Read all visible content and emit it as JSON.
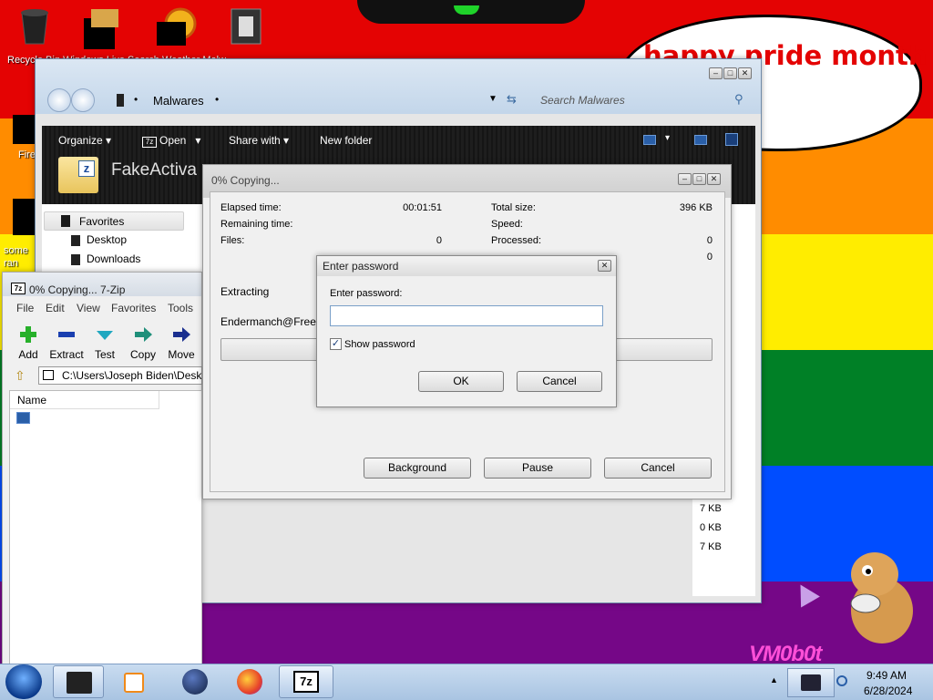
{
  "desktop": {
    "icons": [
      {
        "label": "Recycle Bin Windows Live Search Weather Malw",
        "icon": "recycle-bin-icon"
      },
      {
        "label": "Fire",
        "icon": "firefox-shortcut-icon"
      },
      {
        "label": "some ran",
        "icon": "file-icon"
      }
    ],
    "speech_bubble": "happy pride month",
    "watermark": "VM0b0t",
    "colors": {
      "red": "#e40303",
      "orange": "#ff8c00",
      "yellow": "#ffed00",
      "green": "#008026",
      "blue": "#004dff",
      "purple": "#750787"
    }
  },
  "explorer": {
    "address_folder": "Malwares",
    "search_placeholder": "Search Malwares",
    "toolbar": {
      "organize": "Organize",
      "open": "Open",
      "share_with": "Share with",
      "new_folder": "New folder"
    },
    "folder_title": "FakeActiva",
    "nav": {
      "favorites": "Favorites",
      "desktop": "Desktop",
      "downloads": "Downloads"
    },
    "sizes": [
      "7 KB",
      "0 KB",
      "7 KB"
    ]
  },
  "sevenzip": {
    "title": "0% Copying... 7-Zip",
    "menu": [
      "File",
      "Edit",
      "View",
      "Favorites",
      "Tools"
    ],
    "tools": [
      {
        "label": "Add",
        "icon": "add-plus-icon"
      },
      {
        "label": "Extract",
        "icon": "extract-minus-icon"
      },
      {
        "label": "Test",
        "icon": "test-check-icon"
      },
      {
        "label": "Copy",
        "icon": "copy-arrow-icon"
      },
      {
        "label": "Move",
        "icon": "move-arrow-icon"
      }
    ],
    "path": "C:\\Users\\Joseph Biden\\Deskt",
    "column_name": "Name"
  },
  "copying": {
    "title": "0% Copying...",
    "elapsed_label": "Elapsed time:",
    "elapsed_value": "00:01:51",
    "remaining_label": "Remaining time:",
    "files_label": "Files:",
    "files_value": "0",
    "total_label": "Total size:",
    "total_value": "396 KB",
    "speed_label": "Speed:",
    "processed_label": "Processed:",
    "processed_value": "0",
    "compressed_value": "0",
    "extracting_label": "Extracting",
    "file_label": "Endermanch@FreeYo",
    "progress": 0,
    "background_button": "Background",
    "pause_button": "Pause",
    "cancel_button": "Cancel"
  },
  "password": {
    "title": "Enter password",
    "prompt": "Enter password:",
    "value": "",
    "show_password": "Show password",
    "show_checked": true,
    "ok_button": "OK",
    "cancel_button": "Cancel"
  },
  "taskbar": {
    "time": "9:49 AM",
    "date": "6/28/2024",
    "items": [
      "start-orb-icon",
      "explorer-task-icon",
      "media-player-icon",
      "globe-icon",
      "firefox-icon",
      "7zip-task-icon"
    ]
  }
}
